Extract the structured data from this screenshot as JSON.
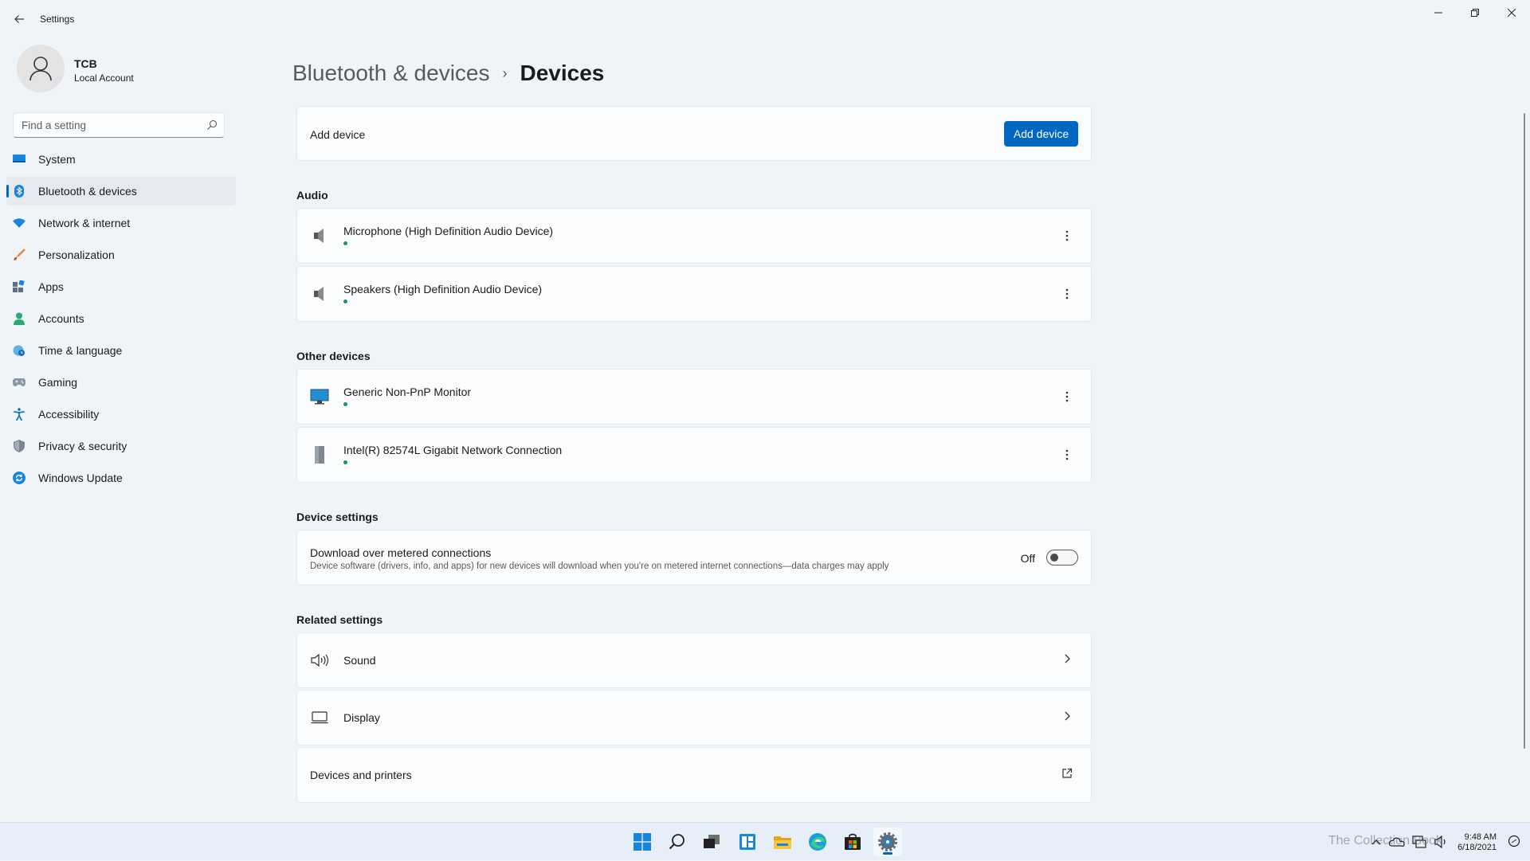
{
  "window": {
    "title": "Settings",
    "controls": {
      "minimize": "minimize-icon",
      "restore": "restore-icon",
      "close": "close-icon"
    }
  },
  "profile": {
    "name": "TCB",
    "subtitle": "Local Account"
  },
  "search": {
    "placeholder": "Find a setting",
    "value": ""
  },
  "nav": [
    {
      "label": "System",
      "icon": "system-icon",
      "active": false
    },
    {
      "label": "Bluetooth & devices",
      "icon": "bluetooth-icon",
      "active": true
    },
    {
      "label": "Network & internet",
      "icon": "wifi-icon",
      "active": false
    },
    {
      "label": "Personalization",
      "icon": "brush-icon",
      "active": false
    },
    {
      "label": "Apps",
      "icon": "apps-icon",
      "active": false
    },
    {
      "label": "Accounts",
      "icon": "person-icon",
      "active": false
    },
    {
      "label": "Time & language",
      "icon": "globe-clock-icon",
      "active": false
    },
    {
      "label": "Gaming",
      "icon": "gamepad-icon",
      "active": false
    },
    {
      "label": "Accessibility",
      "icon": "accessibility-icon",
      "active": false
    },
    {
      "label": "Privacy & security",
      "icon": "shield-icon",
      "active": false
    },
    {
      "label": "Windows Update",
      "icon": "update-icon",
      "active": false
    }
  ],
  "breadcrumb": {
    "parent": "Bluetooth & devices",
    "separator": "›",
    "current": "Devices"
  },
  "add_device": {
    "label": "Add device",
    "button": "Add device"
  },
  "audio": {
    "title": "Audio",
    "devices": [
      {
        "name": "Microphone (High Definition Audio Device)",
        "icon": "speaker-device-icon",
        "status": "connected"
      },
      {
        "name": "Speakers (High Definition Audio Device)",
        "icon": "speaker-device-icon",
        "status": "connected"
      }
    ]
  },
  "other": {
    "title": "Other devices",
    "devices": [
      {
        "name": "Generic Non-PnP Monitor",
        "icon": "monitor-icon",
        "status": "connected"
      },
      {
        "name": "Intel(R) 82574L Gigabit Network Connection",
        "icon": "network-adapter-icon",
        "status": "connected"
      }
    ]
  },
  "device_settings": {
    "title": "Device settings",
    "metered": {
      "title": "Download over metered connections",
      "description": "Device software (drivers, info, and apps) for new devices will download when you're on metered internet connections—data charges may apply",
      "state": "Off",
      "enabled": false
    }
  },
  "related": {
    "title": "Related settings",
    "items": [
      {
        "label": "Sound",
        "icon": "sound-icon",
        "action": "chevron-right-icon"
      },
      {
        "label": "Display",
        "icon": "display-icon",
        "action": "chevron-right-icon"
      },
      {
        "label": "Devices and printers",
        "icon": "",
        "action": "external-link-icon"
      }
    ]
  },
  "taskbar": {
    "apps": [
      "windows-start-icon",
      "search-icon",
      "task-view-icon",
      "widgets-icon",
      "file-explorer-icon",
      "edge-icon",
      "store-icon",
      "settings-icon"
    ],
    "active_app": "settings-icon",
    "tray": [
      "chevron-up-icon",
      "onedrive-icon",
      "network-icon",
      "volume-icon"
    ],
    "time": "9:48 AM",
    "date": "6/18/2021",
    "watermark": "The Collection Book"
  },
  "colors": {
    "accent": "#0067c0",
    "status_connected": "#0f9d58",
    "background": "#eff4f9",
    "card": "#fbfcfd"
  }
}
